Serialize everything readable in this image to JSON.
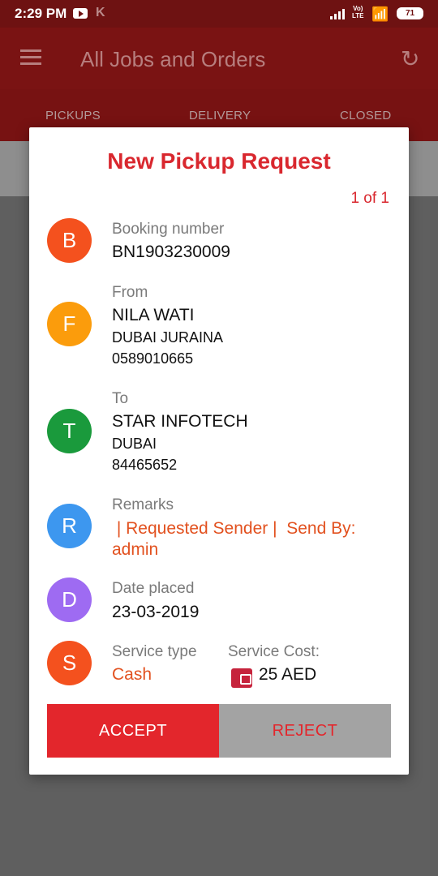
{
  "status": {
    "time": "2:29 PM",
    "battery": "71",
    "volte_top": "Vo)",
    "volte_bottom": "LTE"
  },
  "appbar": {
    "title": "All Jobs and Orders"
  },
  "tabs": [
    "PICKUPS",
    "DELIVERY",
    "CLOSED"
  ],
  "dialog": {
    "title": "New Pickup Request",
    "counter": "1 of 1",
    "booking": {
      "letter": "B",
      "label": "Booking number",
      "value": "BN1903230009"
    },
    "from": {
      "letter": "F",
      "label": "From",
      "name": "NILA WATI",
      "city": "DUBAI JURAINA",
      "phone": "0589010665"
    },
    "to": {
      "letter": "T",
      "label": "To",
      "name": "STAR INFOTECH",
      "city": "DUBAI",
      "phone": "84465652"
    },
    "remarks": {
      "letter": "R",
      "label": "Remarks",
      "line1": " | Requested Sender |  Send By:",
      "line2": "admin"
    },
    "date": {
      "letter": "D",
      "label": "Date placed",
      "value": "23-03-2019"
    },
    "service": {
      "letter": "S",
      "type_label": "Service type",
      "type_value": "Cash",
      "cost_label": "Service Cost:",
      "cost_value": "25 AED"
    },
    "accept_label": "ACCEPT",
    "reject_label": "REJECT"
  },
  "colors": {
    "accent": "#d9272e",
    "avatar_b": "#f4511e",
    "avatar_f": "#fb9c0c",
    "avatar_t": "#1a9a3c",
    "avatar_r": "#3d97ef",
    "avatar_d": "#9e6bf2",
    "avatar_s": "#f4511e"
  }
}
